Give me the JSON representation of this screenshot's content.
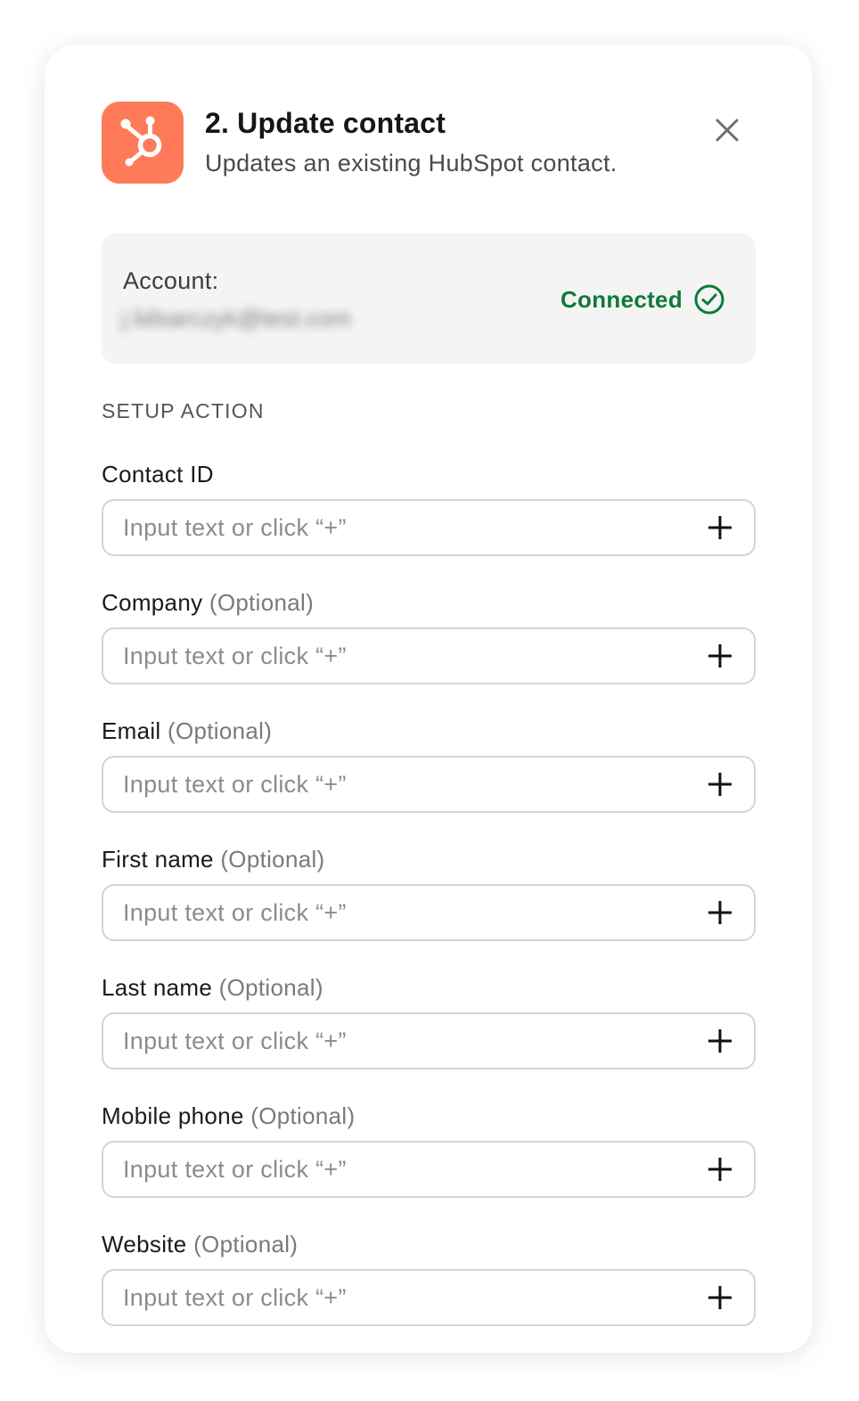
{
  "header": {
    "title": "2. Update contact",
    "subtitle": "Updates an existing HubSpot contact.",
    "app_icon": "hubspot-logo",
    "brand_color": "#ff7a59"
  },
  "account": {
    "label": "Account:",
    "value": "j.lidsarczyk@test.com",
    "status": "Connected",
    "status_color": "#0f7a3a"
  },
  "section_title": "SETUP ACTION",
  "fields": [
    {
      "label": "Contact ID",
      "optional": "",
      "placeholder": "Input text or click “+”"
    },
    {
      "label": "Company",
      "optional": "(Optional)",
      "placeholder": "Input text or click “+”"
    },
    {
      "label": "Email",
      "optional": "(Optional)",
      "placeholder": "Input text or click “+”"
    },
    {
      "label": "First name",
      "optional": "(Optional)",
      "placeholder": "Input text or click “+”"
    },
    {
      "label": "Last name",
      "optional": "(Optional)",
      "placeholder": "Input text or click “+”"
    },
    {
      "label": "Mobile phone",
      "optional": "(Optional)",
      "placeholder": "Input text or click “+”"
    },
    {
      "label": "Website",
      "optional": "(Optional)",
      "placeholder": "Input text or click “+”"
    }
  ]
}
